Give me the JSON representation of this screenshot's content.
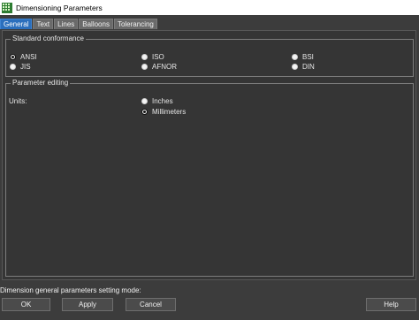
{
  "window": {
    "title": "Dimensioning Parameters"
  },
  "tabs": [
    {
      "label": "General"
    },
    {
      "label": "Text"
    },
    {
      "label": "Lines"
    },
    {
      "label": "Balloons"
    },
    {
      "label": "Tolerancing"
    }
  ],
  "standard": {
    "title": "Standard conformance",
    "options": [
      {
        "label": "ANSI",
        "checked": true
      },
      {
        "label": "ISO",
        "checked": false
      },
      {
        "label": "BSI",
        "checked": false
      },
      {
        "label": "JIS",
        "checked": false
      },
      {
        "label": "AFNOR",
        "checked": false
      },
      {
        "label": "DIN",
        "checked": false
      }
    ]
  },
  "param": {
    "title": "Parameter editing",
    "units_label": "Units:",
    "options": [
      {
        "label": "Inches",
        "checked": false
      },
      {
        "label": "Millimeters",
        "checked": true
      }
    ]
  },
  "status": {
    "text": "Dimension general parameters setting mode:"
  },
  "buttons": {
    "ok": "OK",
    "apply": "Apply",
    "cancel": "Cancel",
    "help": "Help"
  },
  "colors": {
    "active_tab": "#2b6fbd",
    "panel": "#353535",
    "background": "#3c3c3c"
  }
}
